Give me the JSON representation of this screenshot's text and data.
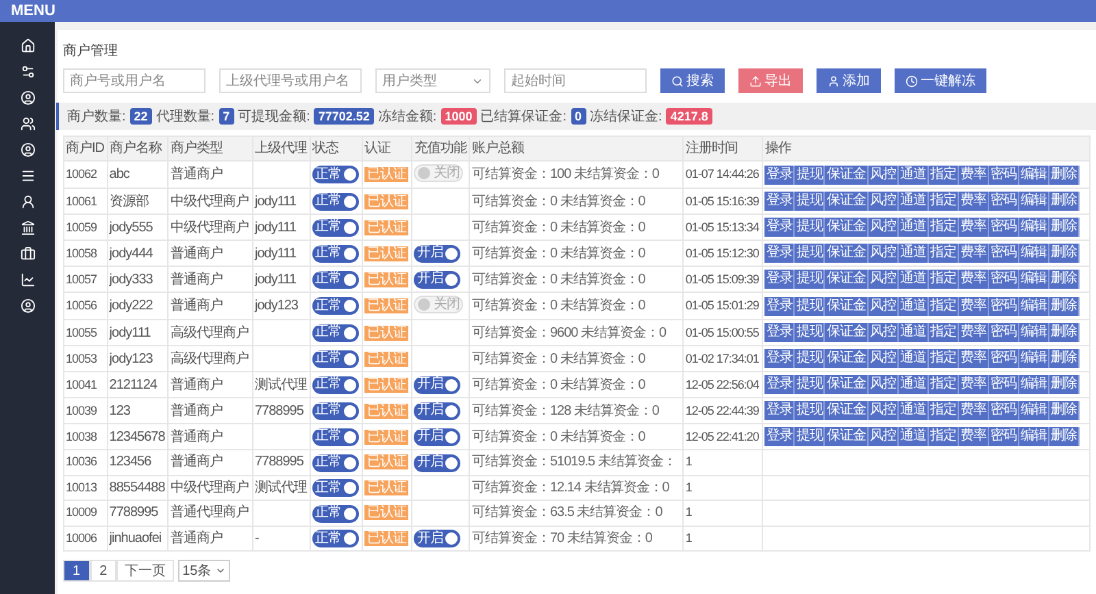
{
  "header": {
    "title": "MENU"
  },
  "page_title": "商户管理",
  "filters": [
    {
      "kind": "input",
      "placeholder": "商户号或用户名"
    },
    {
      "kind": "input",
      "placeholder": "上级代理号或用户名"
    },
    {
      "kind": "select",
      "placeholder": "用户类型"
    },
    {
      "kind": "input",
      "placeholder": "起始时间"
    }
  ],
  "buttons": [
    {
      "label": "搜索",
      "kind": "search"
    },
    {
      "label": "导出",
      "kind": "export"
    },
    {
      "label": "添加",
      "kind": "add"
    },
    {
      "label": "一键解冻",
      "kind": "unfreeze"
    }
  ],
  "stats": [
    {
      "label": "商户数量:",
      "value": "22",
      "color": "#3f5fb8"
    },
    {
      "label": "代理数量:",
      "value": "7",
      "color": "#3f5fb8"
    },
    {
      "label": "可提现金额:",
      "value": "77702.52",
      "color": "#3f5fb8"
    },
    {
      "label": "冻结金额:",
      "value": "1000",
      "color": "#e9556b"
    },
    {
      "label": "已结算保证金:",
      "value": "0",
      "color": "#3f5fb8"
    },
    {
      "label": "冻结保证金:",
      "value": "4217.8",
      "color": "#e9556b"
    }
  ],
  "table": {
    "columns": [
      "商户ID",
      "商户名称",
      "商户类型",
      "上级代理",
      "状态",
      "认证",
      "充值功能",
      "账户总额",
      "注册时间",
      "操作"
    ],
    "rows": [
      {
        "id": "10062",
        "name": "abc",
        "type": "普通商户",
        "agent": "",
        "status": {
          "label": "正常",
          "on": true
        },
        "auth": "已认证",
        "recharge": {
          "label": "关闭",
          "on": false
        },
        "total": "可结算资金：100 未结算资金：0",
        "time": "01-07 14:44:26",
        "actions": [
          "登录",
          "提现",
          "保证金",
          "风控",
          "通道",
          "指定",
          "费率",
          "密码",
          "编辑",
          "删除"
        ]
      },
      {
        "id": "10061",
        "name": "资源部",
        "type": "中级代理商户",
        "agent": "jody111",
        "status": {
          "label": "正常",
          "on": true
        },
        "auth": "已认证",
        "total": "可结算资金：0 未结算资金：0",
        "time": "01-05 15:16:39",
        "actions": [
          "登录",
          "提现",
          "保证金",
          "风控",
          "通道",
          "指定",
          "费率",
          "密码",
          "编辑",
          "删除"
        ]
      },
      {
        "id": "10059",
        "name": "jody555",
        "type": "中级代理商户",
        "agent": "jody111",
        "status": {
          "label": "正常",
          "on": true
        },
        "auth": "已认证",
        "total": "可结算资金：0 未结算资金：0",
        "time": "01-05 15:13:34",
        "actions": [
          "登录",
          "提现",
          "保证金",
          "风控",
          "通道",
          "指定",
          "费率",
          "密码",
          "编辑",
          "删除"
        ]
      },
      {
        "id": "10058",
        "name": "jody444",
        "type": "普通商户",
        "agent": "jody111",
        "status": {
          "label": "正常",
          "on": true
        },
        "auth": "已认证",
        "recharge": {
          "label": "开启",
          "on": true
        },
        "total": "可结算资金：0 未结算资金：0",
        "time": "01-05 15:12:30",
        "actions": [
          "登录",
          "提现",
          "保证金",
          "风控",
          "通道",
          "指定",
          "费率",
          "密码",
          "编辑",
          "删除"
        ]
      },
      {
        "id": "10057",
        "name": "jody333",
        "type": "普通商户",
        "agent": "jody111",
        "status": {
          "label": "正常",
          "on": true
        },
        "auth": "已认证",
        "recharge": {
          "label": "开启",
          "on": true
        },
        "total": "可结算资金：0 未结算资金：0",
        "time": "01-05 15:09:39",
        "actions": [
          "登录",
          "提现",
          "保证金",
          "风控",
          "通道",
          "指定",
          "费率",
          "密码",
          "编辑",
          "删除"
        ]
      },
      {
        "id": "10056",
        "name": "jody222",
        "type": "普通商户",
        "agent": "jody123",
        "status": {
          "label": "正常",
          "on": true
        },
        "auth": "已认证",
        "recharge": {
          "label": "关闭",
          "on": false
        },
        "total": "可结算资金：0 未结算资金：0",
        "time": "01-05 15:01:29",
        "actions": [
          "登录",
          "提现",
          "保证金",
          "风控",
          "通道",
          "指定",
          "费率",
          "密码",
          "编辑",
          "删除"
        ]
      },
      {
        "id": "10055",
        "name": "jody111",
        "type": "高级代理商户",
        "agent": "",
        "status": {
          "label": "正常",
          "on": true
        },
        "auth": "已认证",
        "total": "可结算资金：9600 未结算资金：0",
        "time": "01-05 15:00:55",
        "actions": [
          "登录",
          "提现",
          "保证金",
          "风控",
          "通道",
          "指定",
          "费率",
          "密码",
          "编辑",
          "删除"
        ]
      },
      {
        "id": "10053",
        "name": "jody123",
        "type": "高级代理商户",
        "agent": "",
        "status": {
          "label": "正常",
          "on": true
        },
        "auth": "已认证",
        "total": "可结算资金：0 未结算资金：0",
        "time": "01-02 17:34:01",
        "actions": [
          "登录",
          "提现",
          "保证金",
          "风控",
          "通道",
          "指定",
          "费率",
          "密码",
          "编辑",
          "删除"
        ]
      },
      {
        "id": "10041",
        "name": "2121124",
        "type": "普通商户",
        "agent": "测试代理",
        "status": {
          "label": "正常",
          "on": true
        },
        "auth": "已认证",
        "recharge": {
          "label": "开启",
          "on": true
        },
        "total": "可结算资金：0 未结算资金：0",
        "time": "12-05 22:56:04",
        "actions": [
          "登录",
          "提现",
          "保证金",
          "风控",
          "通道",
          "指定",
          "费率",
          "密码",
          "编辑",
          "删除"
        ]
      },
      {
        "id": "10039",
        "name": "123",
        "type": "普通商户",
        "agent": "7788995",
        "status": {
          "label": "正常",
          "on": true
        },
        "auth": "已认证",
        "recharge": {
          "label": "开启",
          "on": true
        },
        "total": "可结算资金：128 未结算资金：0",
        "time": "12-05 22:44:39",
        "actions": [
          "登录",
          "提现",
          "保证金",
          "风控",
          "通道",
          "指定",
          "费率",
          "密码",
          "编辑",
          "删除"
        ]
      },
      {
        "id": "10038",
        "name": "12345678",
        "type": "普通商户",
        "agent": "",
        "status": {
          "label": "正常",
          "on": true
        },
        "auth": "已认证",
        "recharge": {
          "label": "开启",
          "on": true
        },
        "total": "可结算资金：0 未结算资金：0",
        "time": "12-05 22:41:20",
        "actions": [
          "登录",
          "提现",
          "保证金",
          "风控",
          "通道",
          "指定",
          "费率",
          "密码",
          "编辑",
          "删除"
        ]
      },
      {
        "id": "10036",
        "name": "123456",
        "type": "普通商户",
        "agent": "7788995",
        "status": {
          "label": "正常",
          "on": true
        },
        "auth": "已认证",
        "recharge": {
          "label": "开启",
          "on": true
        },
        "total": "可结算资金：51019.5 未结算资金：",
        "time": "1"
      },
      {
        "id": "10013",
        "name": "88554488",
        "type": "中级代理商户",
        "agent": "测试代理",
        "status": {
          "label": "正常",
          "on": true
        },
        "auth": "已认证",
        "total": "可结算资金：12.14 未结算资金：0",
        "time": "1"
      },
      {
        "id": "10009",
        "name": "7788995",
        "type": "普通代理商户",
        "agent": "",
        "status": {
          "label": "正常",
          "on": true
        },
        "auth": "已认证",
        "total": "可结算资金：63.5 未结算资金：0",
        "time": "1"
      },
      {
        "id": "10006",
        "name": "jinhuaofei",
        "type": "普通商户",
        "agent": "-",
        "status": {
          "label": "正常",
          "on": true
        },
        "auth": "已认证",
        "recharge": {
          "label": "开启",
          "on": true
        },
        "total": "可结算资金：70 未结算资金：0",
        "time": "1"
      }
    ]
  },
  "pagination": {
    "pages": [
      {
        "label": "1",
        "selected": true
      },
      {
        "label": "2",
        "selected": false
      }
    ],
    "next": "下一页",
    "page_size": "15条"
  }
}
